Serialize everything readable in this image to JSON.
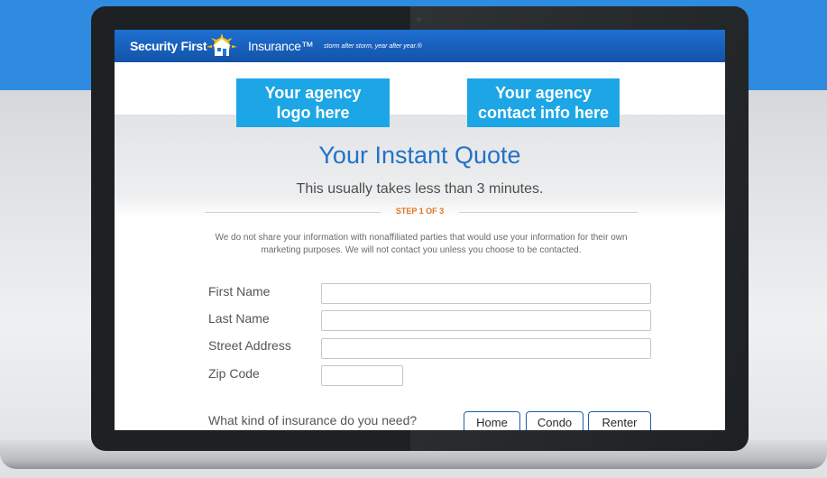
{
  "brand": {
    "name_part1": "Security First",
    "name_part2": "Insurance™",
    "tagline": "storm after storm, year after year.®",
    "colors": {
      "topbar": "#1253a8",
      "accent": "#1da6e6",
      "step": "#e4761f"
    }
  },
  "agency": {
    "logo_placeholder": "Your agency logo here",
    "contact_placeholder": "Your agency contact info here"
  },
  "quote": {
    "title": "Your Instant Quote",
    "subtitle": "This usually takes less than 3 minutes.",
    "step": "STEP 1 OF 3",
    "privacy": "We do not share your information with nonaffiliated parties that would use your information for their own marketing purposes. We will not contact you unless you choose to be contacted."
  },
  "form": {
    "first_name_label": "First Name",
    "last_name_label": "Last Name",
    "street_label": "Street Address",
    "zip_label": "Zip Code",
    "first_name_value": "",
    "last_name_value": "",
    "street_value": "",
    "zip_value": "",
    "insurance_question": "What kind of insurance do you need?",
    "insurance_options": [
      "Home",
      "Condo",
      "Renter"
    ]
  }
}
